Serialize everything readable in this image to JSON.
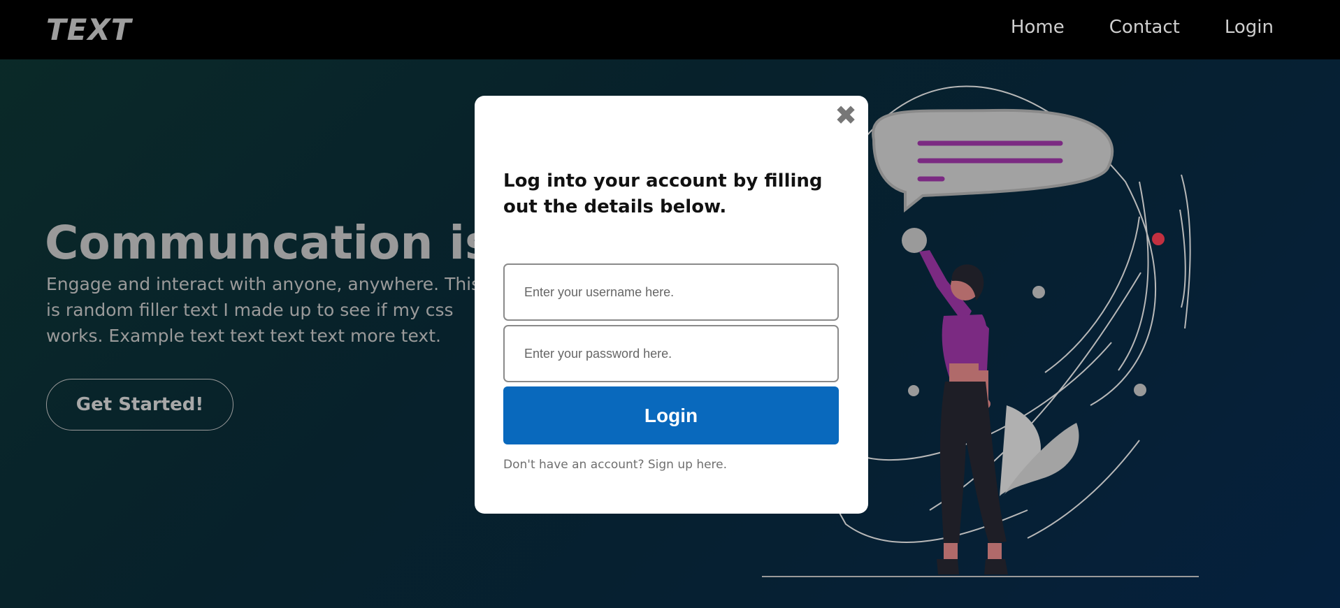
{
  "navbar": {
    "logo": "TEXT",
    "links": [
      "Home",
      "Contact",
      "Login"
    ]
  },
  "hero": {
    "title": "Communcation is th",
    "text": "Engage and interact with anyone, anywhere. This is random filler text I made up to see if my css works. Example text text text text more text.",
    "cta_label": "Get Started!"
  },
  "modal": {
    "close_symbol": "✖",
    "heading": "Log into your account by filling out the details below.",
    "username_placeholder": "Enter your username here.",
    "password_placeholder": "Enter your password here.",
    "login_label": "Login",
    "signup_text": "Don't have an account? Sign up here."
  },
  "colors": {
    "modal_button": "#0969bd",
    "accent_purple": "#7b2a82",
    "accent_red": "#c23040"
  }
}
